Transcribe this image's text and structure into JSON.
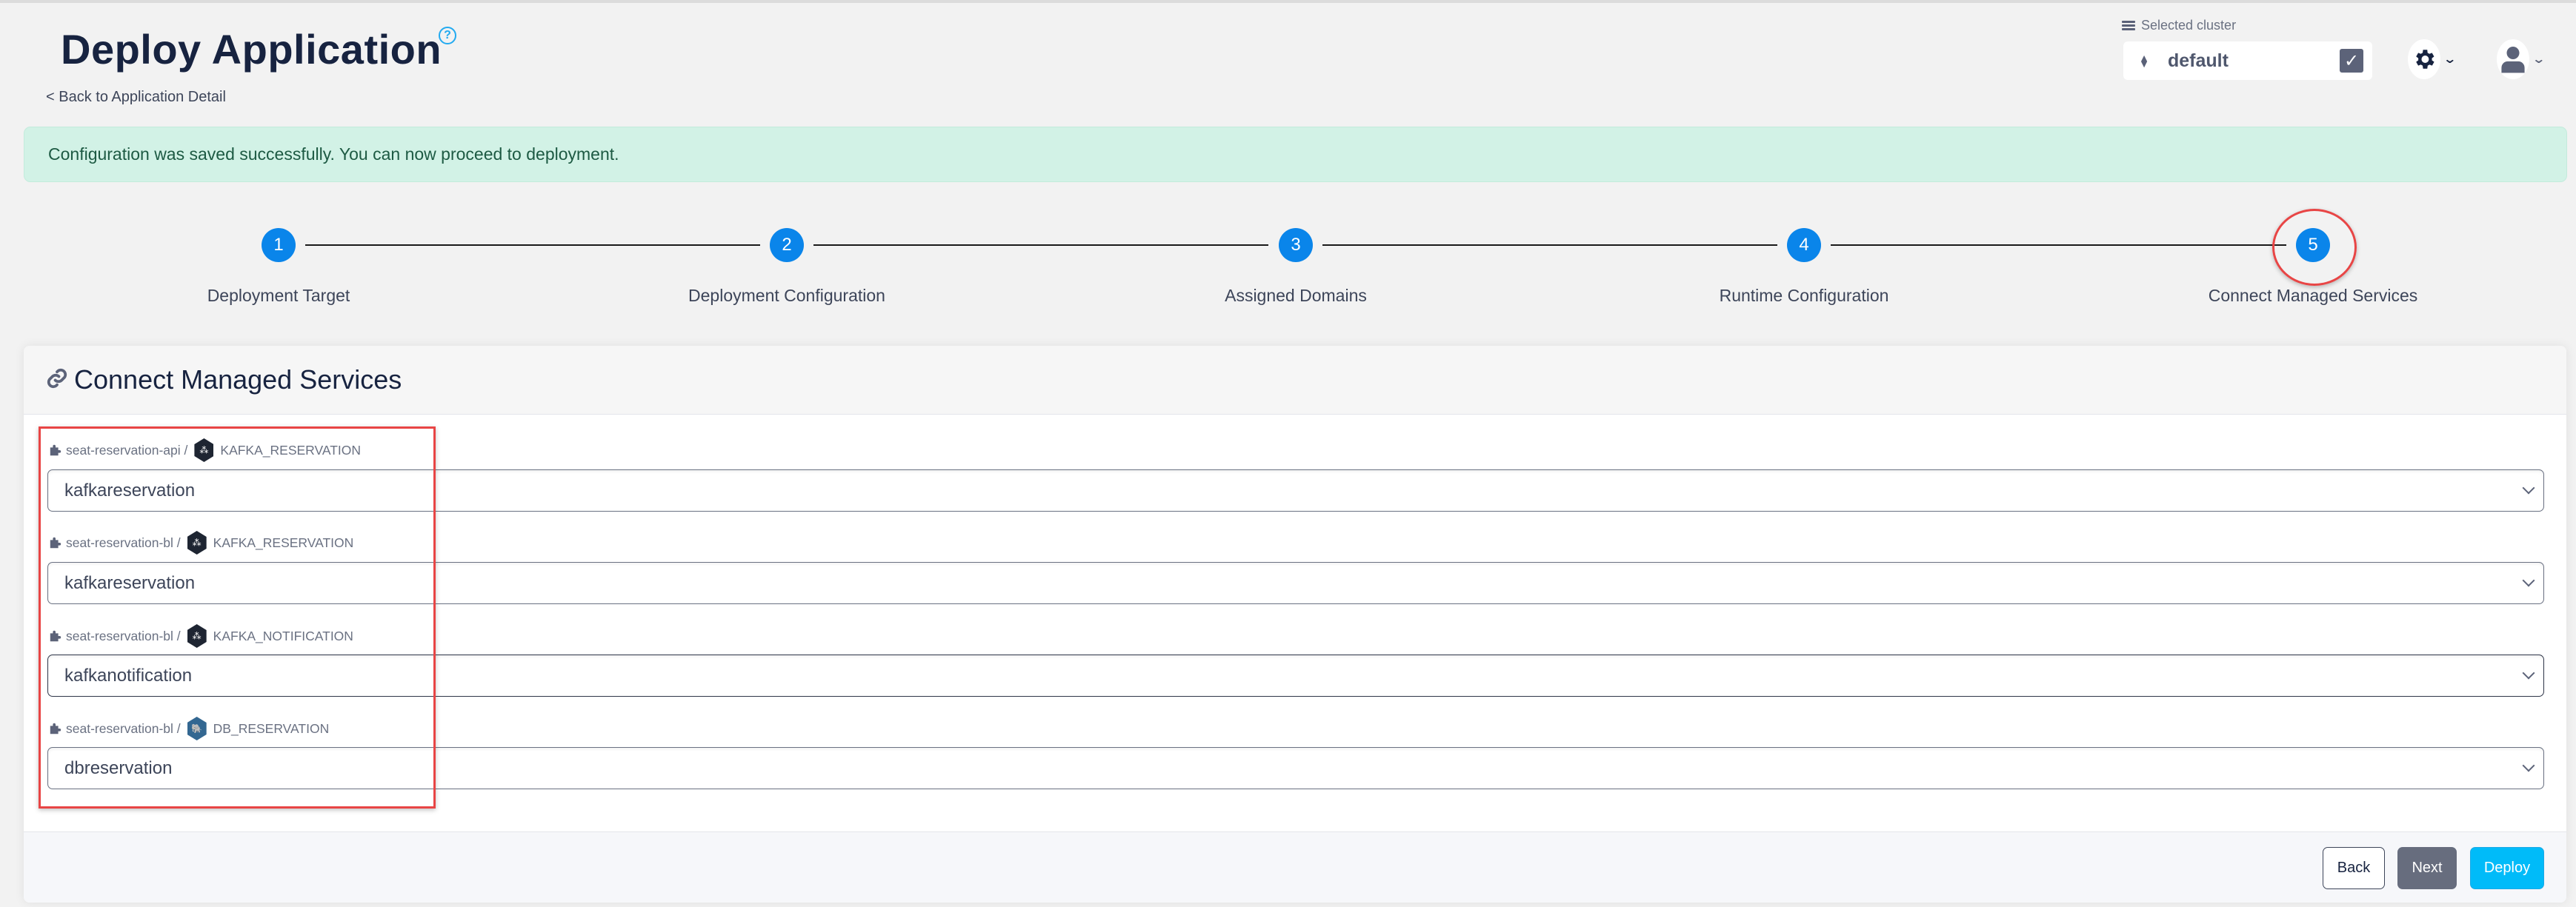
{
  "header": {
    "title": "Deploy Application",
    "help_icon": "question-circle-icon",
    "back_link": "< Back to Application Detail",
    "cluster_label": "Selected cluster",
    "cluster_value": "default",
    "settings_icon": "gear-icon",
    "user_icon": "user-icon"
  },
  "alert": {
    "message": "Configuration was saved successfully. You can now proceed to deployment.",
    "color": "#d2f2e6"
  },
  "stepper": {
    "steps": [
      {
        "number": "1",
        "label": "Deployment Target"
      },
      {
        "number": "2",
        "label": "Deployment Configuration"
      },
      {
        "number": "3",
        "label": "Assigned Domains"
      },
      {
        "number": "4",
        "label": "Runtime Configuration"
      },
      {
        "number": "5",
        "label": "Connect Managed Services"
      }
    ],
    "active_step": 5,
    "accent": "#0a85ea"
  },
  "card": {
    "title": "Connect Managed Services",
    "title_icon": "link-icon",
    "services": [
      {
        "component": "seat-reservation-api /",
        "service_type": "kafka",
        "binding": "KAFKA_RESERVATION",
        "selected": "kafkareservation"
      },
      {
        "component": "seat-reservation-bl /",
        "service_type": "kafka",
        "binding": "KAFKA_RESERVATION",
        "selected": "kafkareservation"
      },
      {
        "component": "seat-reservation-bl /",
        "service_type": "kafka",
        "binding": "KAFKA_NOTIFICATION",
        "selected": "kafkanotification"
      },
      {
        "component": "seat-reservation-bl /",
        "service_type": "postgres",
        "binding": "DB_RESERVATION",
        "selected": "dbreservation"
      }
    ],
    "buttons": {
      "back": "Back",
      "next": "Next",
      "deploy": "Deploy"
    }
  }
}
